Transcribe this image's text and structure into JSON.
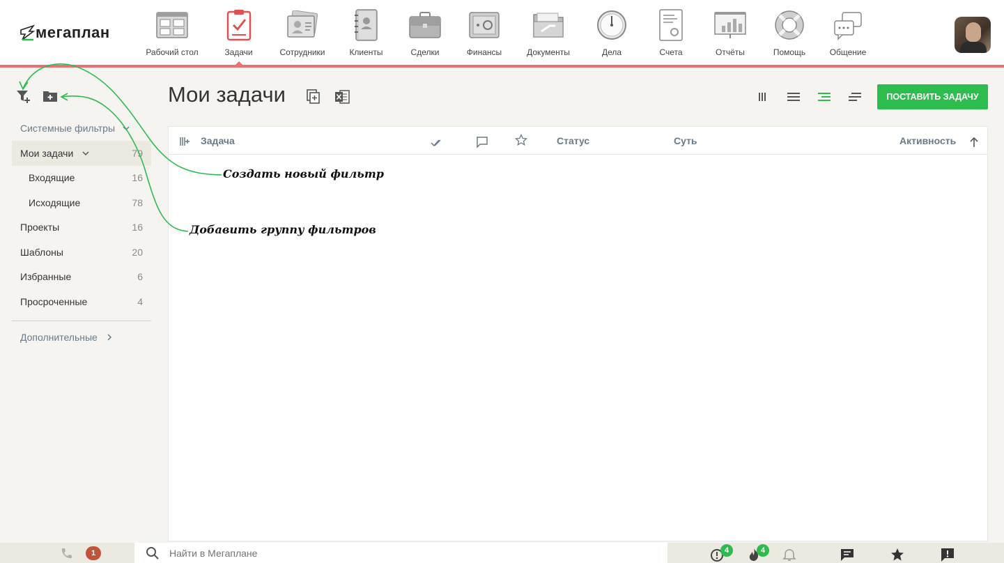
{
  "app": {
    "logo_text": "мегаплан"
  },
  "nav": {
    "items": [
      {
        "label": "Рабочий стол",
        "icon": "desktop-icon"
      },
      {
        "label": "Задачи",
        "icon": "tasks-icon",
        "active": true
      },
      {
        "label": "Сотрудники",
        "icon": "employees-icon"
      },
      {
        "label": "Клиенты",
        "icon": "clients-icon"
      },
      {
        "label": "Сделки",
        "icon": "deals-icon"
      },
      {
        "label": "Финансы",
        "icon": "finance-icon"
      },
      {
        "label": "Документы",
        "icon": "documents-icon"
      },
      {
        "label": "Дела",
        "icon": "clock-icon"
      },
      {
        "label": "Счета",
        "icon": "invoices-icon"
      },
      {
        "label": "Отчёты",
        "icon": "reports-icon"
      },
      {
        "label": "Помощь",
        "icon": "lifebuoy-icon"
      },
      {
        "label": "Общение",
        "icon": "chat-icon"
      }
    ]
  },
  "sidebar": {
    "system_filters_label": "Системные фильтры",
    "filters": [
      {
        "label": "Мои задачи",
        "count": "79"
      },
      {
        "label": "Входящие",
        "count": "16"
      },
      {
        "label": "Исходящие",
        "count": "78"
      },
      {
        "label": "Проекты",
        "count": "16"
      },
      {
        "label": "Шаблоны",
        "count": "20"
      },
      {
        "label": "Избранные",
        "count": "6"
      },
      {
        "label": "Просроченные",
        "count": "4"
      }
    ],
    "more_label": "Дополнительные"
  },
  "header": {
    "title": "Мои задачи",
    "primary_button": "ПОСТАВИТЬ ЗАДАЧУ"
  },
  "table": {
    "columns": {
      "task": "Задача",
      "status": "Статус",
      "essence": "Суть",
      "activity": "Активность"
    }
  },
  "annotations": {
    "create_filter": "Создать новый фильтр",
    "add_group": "Добавить группу фильтров"
  },
  "bottom": {
    "search_placeholder": "Найти в Мегаплане",
    "missed_calls": "1",
    "alerts": "4",
    "hot": "4"
  },
  "colors": {
    "accent": "#2dbc4e",
    "nav_underline": "#e57373",
    "annotation_arrow": "#2dbc4e"
  }
}
